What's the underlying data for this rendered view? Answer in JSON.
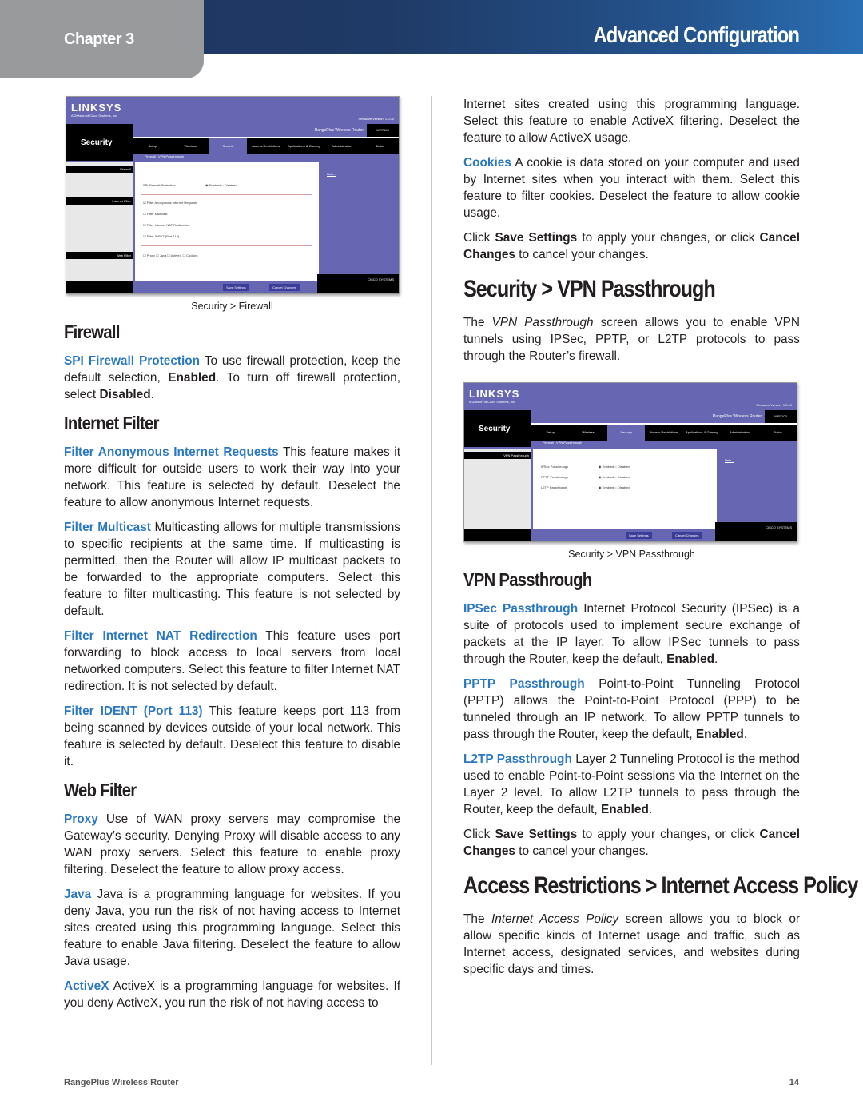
{
  "header": {
    "chapter": "Chapter 3",
    "title": "Advanced Configuration"
  },
  "left": {
    "firewall_screenshot": {
      "logo": "LINKSYS",
      "logo_sub": "A Division of Cisco Systems, Inc.",
      "firmware": "Firmware Version: 1.0.00",
      "section": "Security",
      "product": "RangePlus Wireless Router",
      "model": "WRT100",
      "tabs": [
        "Setup",
        "Wireless",
        "Security",
        "Access Restrictions",
        "Applications & Gaming",
        "Administration",
        "Status"
      ],
      "subtabs": "Firewall   |   VPN Passthrough",
      "labels": [
        "Firewall",
        "Internet Filter",
        "Web Filter"
      ],
      "spi_label": "SPI Firewall Protection",
      "spi_options": "◉ Enabled  ○ Disabled",
      "filters": [
        "☑ Filter Anonymous Internet Requests",
        "☐ Filter Multicast",
        "☐ Filter Internet NAT Redirection",
        "☑ Filter IDENT (Port 113)"
      ],
      "web_filters": "☐ Proxy  ☐ Java  ☐ ActiveX  ☐ Cookies",
      "help": "Help...",
      "save": "Save Settings",
      "cancel": "Cancel Changes",
      "cisco": "CISCO SYSTEMS"
    },
    "firewall_caption": "Security > Firewall",
    "firewall_heading": "Firewall",
    "spi_term": "SPI Firewall Protection",
    "spi_text_1": " To use firewall protection, keep the default selection, ",
    "spi_bold_1": "Enabled",
    "spi_text_2": ". To turn off firewall protection, select ",
    "spi_bold_2": "Disabled",
    "spi_text_3": ".",
    "internet_filter_heading": "Internet Filter",
    "fair_term": "Filter Anonymous Internet Requests",
    "fair_text": " This feature makes it more difficult for outside users to work their way into your network. This feature is selected by default. Deselect the feature to allow anonymous Internet requests.",
    "multicast_term": "Filter Multicast",
    "multicast_text": " Multicasting allows for multiple transmissions to specific recipients at the same time. If multicasting is permitted, then the Router will allow IP multicast packets to be forwarded to the appropriate computers. Select this feature to filter multicasting. This feature is not selected by default.",
    "nat_term": "Filter Internet NAT Redirection",
    "nat_text": " This feature uses port forwarding to block access to local servers from local networked computers. Select this feature to filter Internet NAT redirection. It is not selected by default.",
    "ident_term": "Filter IDENT (Port 113)",
    "ident_text": " This feature keeps port 113 from being scanned by devices outside of your local network. This feature is selected by default. Deselect this feature to disable it.",
    "web_filter_heading": "Web Filter",
    "proxy_term": "Proxy",
    "proxy_text": " Use of WAN proxy servers may compromise the Gateway’s security. Denying Proxy will disable access to any WAN proxy servers. Select this feature to enable proxy filtering. Deselect the feature to allow proxy access.",
    "java_term": "Java",
    "java_text": " Java is a programming language for websites. If you deny Java, you run the risk of not having access to Internet sites created using this programming language. Select this feature to enable Java filtering. Deselect the feature to allow Java usage.",
    "activex_term": "ActiveX",
    "activex_text": " ActiveX is a programming language for websites. If you deny ActiveX, you run the risk of not having access to"
  },
  "right": {
    "activex_cont": "Internet sites created using this programming language. Select this feature to enable ActiveX filtering. Deselect the feature to allow ActiveX usage.",
    "cookies_term": "Cookies",
    "cookies_text": " A cookie is data stored on your computer and used by Internet sites when you interact with them. Select this feature to filter cookies. Deselect the feature to allow cookie usage.",
    "save1_a": "Click ",
    "save1_b": "Save Settings",
    "save1_c": " to apply your changes, or click ",
    "save1_d": "Cancel Changes",
    "save1_e": " to cancel your changes.",
    "vpn_section_heading": "Security > VPN Passthrough",
    "vpn_intro_a": "The ",
    "vpn_intro_em": "VPN Passthrough",
    "vpn_intro_b": " screen allows you to enable VPN tunnels using IPSec, PPTP, or L2TP protocols to pass through the Router’s firewall.",
    "vpn_screenshot": {
      "logo": "LINKSYS",
      "logo_sub": "A Division of Cisco Systems, Inc.",
      "firmware": "Firmware Version: 1.0.00",
      "section": "Security",
      "product": "RangePlus Wireless Router",
      "model": "WRT100",
      "tabs": [
        "Setup",
        "Wireless",
        "Security",
        "Access Restrictions",
        "Applications & Gaming",
        "Administration",
        "Status"
      ],
      "subtabs": "Firewall   |   VPN Passthrough",
      "label": "VPN Passthrough",
      "rows": [
        {
          "name": "IPSec Passthrough",
          "value": "◉ Enabled  ○ Disabled"
        },
        {
          "name": "PPTP Passthrough",
          "value": "◉ Enabled  ○ Disabled"
        },
        {
          "name": "L2TP Passthrough",
          "value": "◉ Enabled  ○ Disabled"
        }
      ],
      "help": "Help...",
      "save": "Save Settings",
      "cancel": "Cancel Changes",
      "cisco": "CISCO SYSTEMS"
    },
    "vpn_caption": "Security > VPN Passthrough",
    "vpn_heading": "VPN Passthrough",
    "ipsec_term": "IPSec Passthrough",
    "ipsec_text": " Internet Protocol Security (IPSec) is a suite of protocols used to implement secure exchange of packets at the IP layer. To allow IPSec tunnels to pass through the Router, keep the default, ",
    "ipsec_bold": "Enabled",
    "pptp_term": "PPTP Passthrough",
    "pptp_text": " Point-to-Point Tunneling Protocol (PPTP) allows the Point-to-Point Protocol (PPP) to be tunneled through an IP network. To allow PPTP tunnels to pass through the Router, keep the default, ",
    "pptp_bold": "Enabled",
    "l2tp_term": "L2TP Passthrough",
    "l2tp_text": " Layer 2 Tunneling Protocol is the method used to enable Point-to-Point sessions via the Internet on the Layer 2 level. To allow L2TP tunnels to pass through the Router, keep the default, ",
    "l2tp_bold": "Enabled",
    "save2_a": "Click ",
    "save2_b": "Save Settings",
    "save2_c": " to apply your changes, or click ",
    "save2_d": "Cancel Changes",
    "save2_e": " to cancel your changes.",
    "access_heading": "Access Restrictions > Internet Access Policy",
    "access_a": "The ",
    "access_em": "Internet Access Policy",
    "access_b": " screen allows you to block or allow specific kinds of Internet usage and traffic, such as Internet access, designated services, and websites during specific days and times."
  },
  "footer": {
    "product": "RangePlus Wireless Router",
    "page": "14"
  }
}
